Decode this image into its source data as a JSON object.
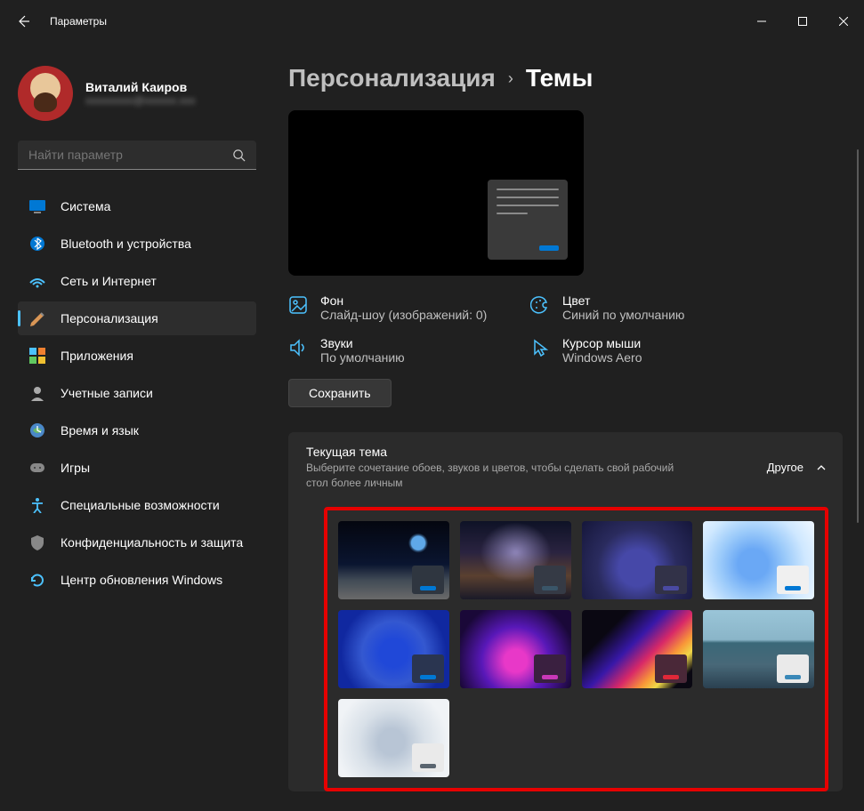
{
  "window": {
    "title": "Параметры"
  },
  "user": {
    "name": "Виталий Каиров",
    "email": "xxxxxxxxx@xxxxxx.xxx"
  },
  "search": {
    "placeholder": "Найти параметр"
  },
  "nav": [
    {
      "label": "Система",
      "icon": "system"
    },
    {
      "label": "Bluetooth и устройства",
      "icon": "bluetooth"
    },
    {
      "label": "Сеть и Интернет",
      "icon": "network"
    },
    {
      "label": "Персонализация",
      "icon": "personalization",
      "active": true
    },
    {
      "label": "Приложения",
      "icon": "apps"
    },
    {
      "label": "Учетные записи",
      "icon": "accounts"
    },
    {
      "label": "Время и язык",
      "icon": "time"
    },
    {
      "label": "Игры",
      "icon": "gaming"
    },
    {
      "label": "Специальные возможности",
      "icon": "accessibility"
    },
    {
      "label": "Конфиденциальность и защита",
      "icon": "privacy"
    },
    {
      "label": "Центр обновления Windows",
      "icon": "update"
    }
  ],
  "breadcrumb": {
    "parent": "Персонализация",
    "current": "Темы"
  },
  "info": {
    "bg": {
      "title": "Фон",
      "sub": "Слайд-шоу (изображений: 0)"
    },
    "color": {
      "title": "Цвет",
      "sub": "Синий по умолчанию"
    },
    "sound": {
      "title": "Звуки",
      "sub": "По умолчанию"
    },
    "cursor": {
      "title": "Курсор мыши",
      "sub": "Windows Aero"
    }
  },
  "save_label": "Сохранить",
  "theme_panel": {
    "title": "Текущая тема",
    "subtitle": "Выберите сочетание обоев, звуков и цветов, чтобы сделать свой рабочий стол более личным",
    "more": "Другое"
  }
}
